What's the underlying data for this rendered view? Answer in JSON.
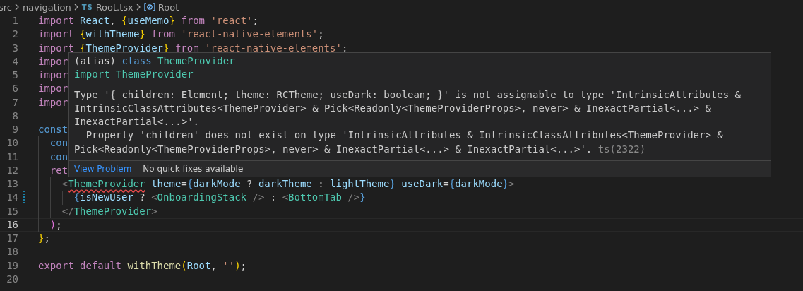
{
  "breadcrumbs": [
    {
      "kind": "folder",
      "label": "src"
    },
    {
      "kind": "folder",
      "label": "navigation"
    },
    {
      "kind": "file",
      "badge": "TS",
      "label": "Root.tsx"
    },
    {
      "kind": "symbol",
      "label": "Root"
    }
  ],
  "editor": {
    "lines": [
      {
        "number": "1",
        "current": false,
        "modified": false,
        "tokens": [
          {
            "text": "import",
            "kind": "keyword"
          },
          {
            "text": " React",
            "kind": "variable"
          },
          {
            "text": ", ",
            "kind": "punct"
          },
          {
            "text": "{",
            "kind": "brace"
          },
          {
            "text": "useMemo",
            "kind": "variable"
          },
          {
            "text": "}",
            "kind": "brace"
          },
          {
            "text": " from ",
            "kind": "keyword"
          },
          {
            "text": "'react'",
            "kind": "string"
          },
          {
            "text": ";",
            "kind": "punct"
          }
        ]
      },
      {
        "number": "2",
        "current": false,
        "modified": false,
        "tokens": [
          {
            "text": "import ",
            "kind": "keyword"
          },
          {
            "text": "{",
            "kind": "brace"
          },
          {
            "text": "withTheme",
            "kind": "variable"
          },
          {
            "text": "}",
            "kind": "brace"
          },
          {
            "text": " from ",
            "kind": "keyword"
          },
          {
            "text": "'react-native-elements'",
            "kind": "string"
          },
          {
            "text": ";",
            "kind": "punct"
          }
        ]
      },
      {
        "number": "3",
        "current": false,
        "modified": false,
        "tokens": [
          {
            "text": "import ",
            "kind": "keyword"
          },
          {
            "text": "{",
            "kind": "brace"
          },
          {
            "text": "ThemeProvider",
            "kind": "variable"
          },
          {
            "text": "}",
            "kind": "brace"
          },
          {
            "text": " from ",
            "kind": "keyword"
          },
          {
            "text": "'react-native-elements'",
            "kind": "string"
          },
          {
            "text": ";",
            "kind": "punct"
          }
        ]
      },
      {
        "number": "4",
        "current": false,
        "modified": false,
        "tokens": [
          {
            "text": "impor",
            "kind": "keyword"
          }
        ]
      },
      {
        "number": "5",
        "current": false,
        "modified": false,
        "tokens": [
          {
            "text": "impor",
            "kind": "keyword"
          }
        ]
      },
      {
        "number": "6",
        "current": false,
        "modified": false,
        "tokens": [
          {
            "text": "impor",
            "kind": "keyword"
          }
        ]
      },
      {
        "number": "7",
        "current": false,
        "modified": false,
        "tokens": [
          {
            "text": "impor",
            "kind": "keyword"
          }
        ]
      },
      {
        "number": "8",
        "current": false,
        "modified": false
      },
      {
        "number": "9",
        "current": false,
        "modified": false,
        "tokens": [
          {
            "text": "const",
            "kind": "storage"
          }
        ]
      },
      {
        "number": "10",
        "current": false,
        "modified": false,
        "tokens": [
          {
            "text": "  con",
            "kind": "storage"
          }
        ]
      },
      {
        "number": "11",
        "current": false,
        "modified": false,
        "tokens": [
          {
            "text": "  con",
            "kind": "storage"
          }
        ]
      },
      {
        "number": "12",
        "current": false,
        "modified": false,
        "tokens": [
          {
            "text": "  ret",
            "kind": "keyword"
          }
        ]
      },
      {
        "number": "13",
        "current": false,
        "modified": false,
        "tokens": [
          {
            "text": "    <",
            "kind": "tag"
          },
          {
            "text": "ThemeProvider",
            "kind": "component",
            "error": true
          },
          {
            "text": " theme",
            "kind": "attribute"
          },
          {
            "text": "=",
            "kind": "punct"
          },
          {
            "text": "{",
            "kind": "jsxbrace"
          },
          {
            "text": "darkMode",
            "kind": "variable"
          },
          {
            "text": " ? ",
            "kind": "punct"
          },
          {
            "text": "darkTheme",
            "kind": "variable"
          },
          {
            "text": " : ",
            "kind": "punct"
          },
          {
            "text": "lightTheme",
            "kind": "variable"
          },
          {
            "text": "}",
            "kind": "jsxbrace"
          },
          {
            "text": " useDark",
            "kind": "attribute"
          },
          {
            "text": "=",
            "kind": "punct"
          },
          {
            "text": "{",
            "kind": "jsxbrace"
          },
          {
            "text": "darkMode",
            "kind": "variable"
          },
          {
            "text": "}",
            "kind": "jsxbrace"
          },
          {
            "text": ">",
            "kind": "tag"
          }
        ]
      },
      {
        "number": "14",
        "current": false,
        "modified": true,
        "tokens": [
          {
            "text": "      {",
            "kind": "jsxbrace"
          },
          {
            "text": "isNewUser",
            "kind": "variable"
          },
          {
            "text": " ? ",
            "kind": "punct"
          },
          {
            "text": "<",
            "kind": "tag"
          },
          {
            "text": "OnboardingStack",
            "kind": "component"
          },
          {
            "text": " />",
            "kind": "tag"
          },
          {
            "text": " : ",
            "kind": "punct"
          },
          {
            "text": "<",
            "kind": "tag"
          },
          {
            "text": "BottomTab",
            "kind": "component"
          },
          {
            "text": " />",
            "kind": "tag"
          },
          {
            "text": "}",
            "kind": "jsxbrace"
          }
        ]
      },
      {
        "number": "15",
        "current": false,
        "modified": false,
        "tokens": [
          {
            "text": "    </",
            "kind": "tag"
          },
          {
            "text": "ThemeProvider",
            "kind": "component"
          },
          {
            "text": ">",
            "kind": "tag"
          }
        ]
      },
      {
        "number": "16",
        "current": true,
        "modified": false,
        "tokens": [
          {
            "text": "  )",
            "kind": "paren"
          },
          {
            "text": ";",
            "kind": "punct"
          }
        ]
      },
      {
        "number": "17",
        "current": false,
        "modified": false,
        "tokens": [
          {
            "text": "}",
            "kind": "brace"
          },
          {
            "text": ";",
            "kind": "punct"
          }
        ]
      },
      {
        "number": "18",
        "current": false,
        "modified": false
      },
      {
        "number": "19",
        "current": false,
        "modified": false,
        "tokens": [
          {
            "text": "export default ",
            "kind": "keyword"
          },
          {
            "text": "withTheme",
            "kind": "function"
          },
          {
            "text": "(",
            "kind": "brace"
          },
          {
            "text": "Root",
            "kind": "variable"
          },
          {
            "text": ", ",
            "kind": "punct"
          },
          {
            "text": "''",
            "kind": "string"
          },
          {
            "text": ")",
            "kind": "brace"
          },
          {
            "text": ";",
            "kind": "punct"
          }
        ]
      },
      {
        "number": "20",
        "current": false,
        "modified": false
      }
    ]
  },
  "hover": {
    "signature": [
      [
        {
          "text": "(alias) ",
          "kind": "punct"
        },
        {
          "text": "class ",
          "kind": "storage"
        },
        {
          "text": "ThemeProvider",
          "kind": "component"
        }
      ],
      [
        {
          "text": "import ",
          "kind": "component"
        },
        {
          "text": "ThemeProvider",
          "kind": "component"
        }
      ]
    ],
    "message_lines": [
      "Type '{ children: Element; theme: RCTheme; useDark: boolean; }' is not assignable to type 'IntrinsicAttributes &",
      "IntrinsicClassAttributes<ThemeProvider> & Pick<Readonly<ThemeProviderProps>, never> & InexactPartial<...> &",
      "InexactPartial<...>'.",
      "  Property 'children' does not exist on type 'IntrinsicAttributes & IntrinsicClassAttributes<ThemeProvider> &",
      "Pick<Readonly<ThemeProviderProps>, never> & InexactPartial<...> & InexactPartial<...>'."
    ],
    "code": "ts(2322)",
    "actions": [
      {
        "kind": "link",
        "label": "View Problem"
      },
      {
        "kind": "note",
        "label": "No quick fixes available"
      }
    ]
  }
}
